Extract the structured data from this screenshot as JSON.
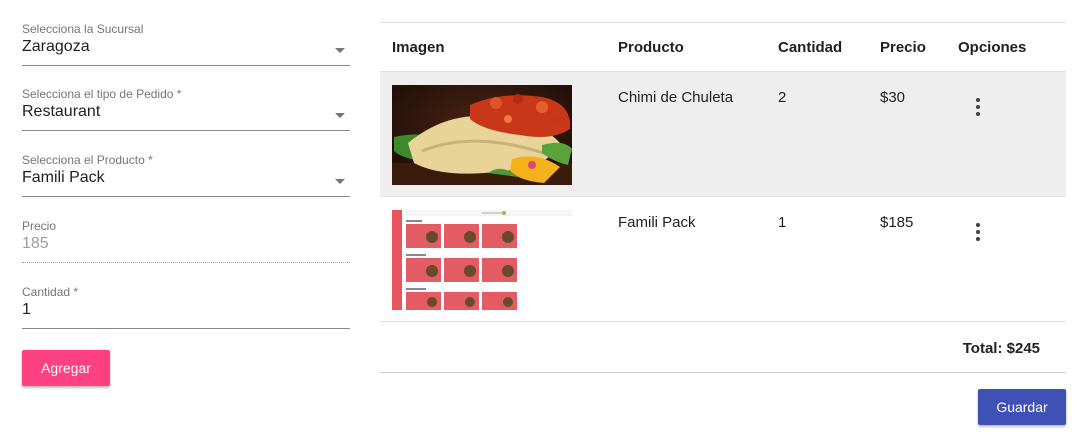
{
  "form": {
    "sucursal": {
      "label": "Selecciona la Sucursal",
      "value": "Zaragoza"
    },
    "tipo_pedido": {
      "label": "Selecciona el tipo de Pedido *",
      "value": "Restaurant"
    },
    "producto": {
      "label": "Selecciona el Producto *",
      "value": "Famili Pack"
    },
    "precio": {
      "label": "Precio",
      "value": "185"
    },
    "cantidad": {
      "label": "Cantidad *",
      "value": "1"
    },
    "add_label": "Agregar"
  },
  "table": {
    "headers": {
      "imagen": "Imagen",
      "producto": "Producto",
      "cantidad": "Cantidad",
      "precio": "Precio",
      "opciones": "Opciones"
    },
    "rows": [
      {
        "producto": "Chimi de Chuleta",
        "cantidad": "2",
        "precio": "$30",
        "image": "food-photo"
      },
      {
        "producto": "Famili Pack",
        "cantidad": "1",
        "precio": "$185",
        "image": "menu-screenshot"
      }
    ],
    "total": "Total: $245"
  },
  "save_label": "Guardar",
  "colors": {
    "accent": "#ff4081",
    "primary": "#3f51b5",
    "row_hover": "#eeeeee"
  },
  "icons": {
    "row_menu": "more-vert-icon",
    "select": "dropdown-arrow-icon"
  }
}
